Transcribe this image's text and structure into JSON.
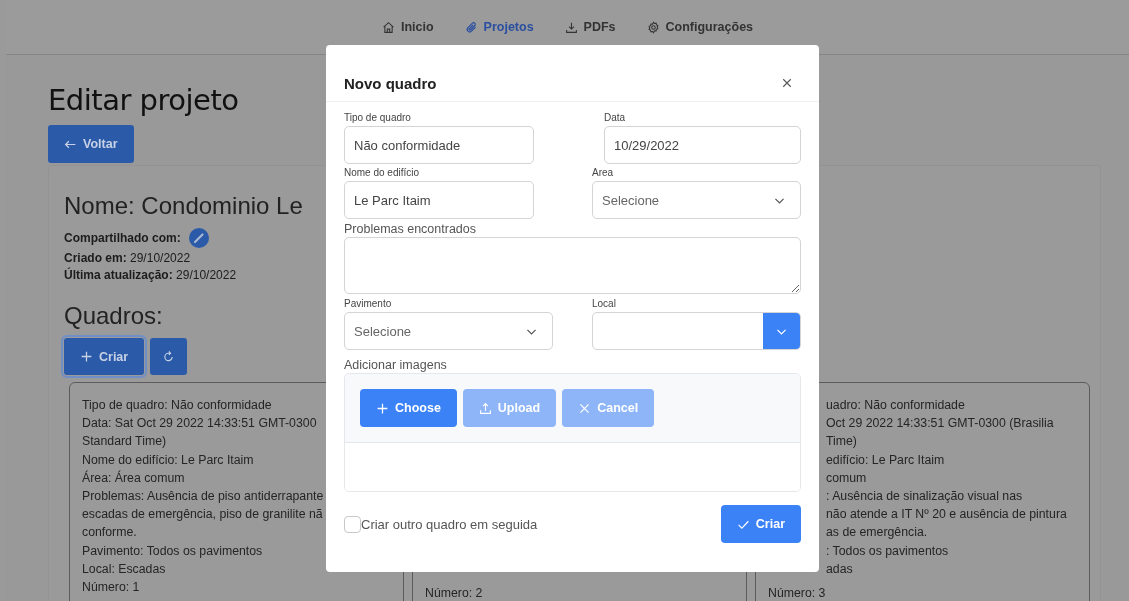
{
  "nav": [
    {
      "label": "Inicio",
      "selected": false
    },
    {
      "label": "Projetos",
      "selected": true
    },
    {
      "label": "PDFs",
      "selected": false
    },
    {
      "label": "Configurações",
      "selected": false
    }
  ],
  "page": {
    "title": "Editar projeto",
    "back_button": "Voltar",
    "project_name": "Nome: Condominio Le",
    "shared_label": "Compartilhado com:",
    "created": "**Criado em:** 29/10/2022",
    "updated": "**Última atualização:** 29/10/2022",
    "section_title": "Quadros:",
    "create_button": "Criar"
  },
  "cards": [
    {
      "lines": [
        "Tipo de quadro: Não conformidade",
        "Data: Sat Oct 29 2022 14:33:51 GMT-0300",
        "Standard Time)",
        "Nome do edifício: Le Parc Itaim",
        "Área: Área comum",
        "Problemas: Ausência de piso antiderrapante",
        "escadas de emergência, piso de granilite nã",
        "conforme.",
        "Pavimento: Todos os pavimentos",
        "Local: Escadas",
        "Número: 1"
      ]
    },
    {
      "lines": [
        "Número: 2"
      ]
    },
    {
      "clipped_lines": [
        "uadro: Não conformidade",
        "Oct 29 2022 14:33:51 GMT-0300 (Brasilia",
        "Time)",
        "edifício: Le Parc Itaim",
        "comum",
        ": Ausência de sinalização visual nas",
        "não atende a IT Nº 20 e ausência de pintura",
        "as de emergência.",
        ": Todos os pavimentos",
        "adas"
      ],
      "lines": [
        "Número: 3"
      ]
    }
  ],
  "dialog": {
    "title": "Novo quadro",
    "type_field": {
      "label": "Tipo de quadro",
      "value": "Não conformidade"
    },
    "date_field": {
      "label": "Data",
      "value": "10/29/2022"
    },
    "building_field": {
      "label": "Nome do edifício",
      "value": "Le Parc Itaim"
    },
    "area_field": {
      "label": "Area",
      "placeholder": "Selecione"
    },
    "problems_field": {
      "label": "Problemas encontrados"
    },
    "floor_field": {
      "label": "Pavimento",
      "placeholder": "Selecione"
    },
    "local_field": {
      "label": "Local"
    },
    "images": {
      "label": "Adicionar imagens",
      "buttons": [
        {
          "label": "Choose",
          "disabled": false
        },
        {
          "label": "Upload",
          "disabled": true
        },
        {
          "label": "Cancel",
          "disabled": true
        }
      ]
    },
    "another_checkbox": {
      "label": "Criar outro quadro em seguida",
      "checked": false
    },
    "submit_button": "Criar"
  }
}
